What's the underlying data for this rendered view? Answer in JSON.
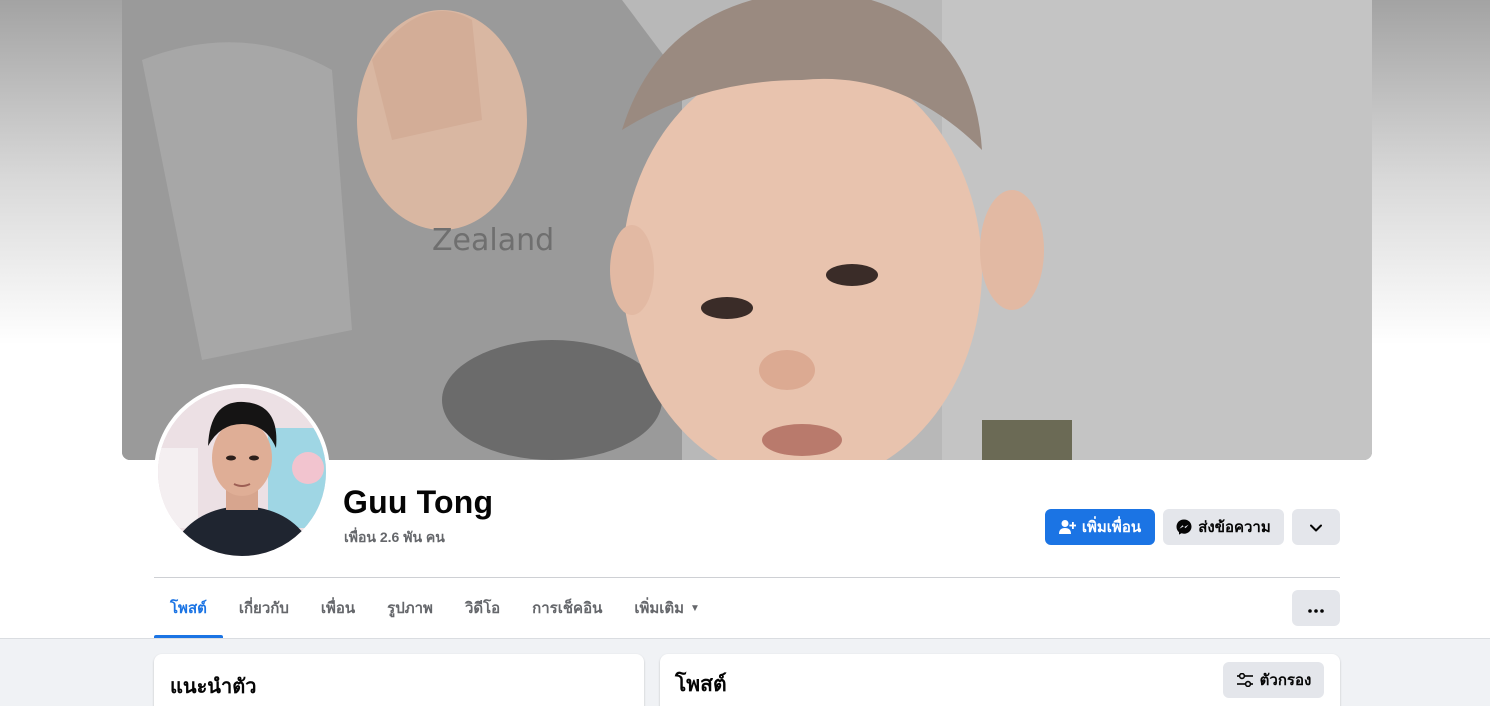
{
  "profile": {
    "name": "Guu Tong",
    "friends": "เพื่อน 2.6 พัน คน"
  },
  "actions": {
    "add_friend": "เพิ่มเพื่อน",
    "message": "ส่งข้อความ"
  },
  "tabs": [
    {
      "label": "โพสต์",
      "active": true
    },
    {
      "label": "เกี่ยวกับ"
    },
    {
      "label": "เพื่อน"
    },
    {
      "label": "รูปภาพ"
    },
    {
      "label": "วิดีโอ"
    },
    {
      "label": "การเช็คอิน"
    },
    {
      "label": "เพิ่มเติม"
    }
  ],
  "intro": {
    "title": "แนะนำตัว"
  },
  "posts": {
    "title": "โพสต์",
    "filter_label": "ตัวกรอง"
  },
  "colors": {
    "accent": "#1b74e4",
    "secondary_button": "#e4e6eb",
    "muted_text": "#65676b",
    "page_bg": "#f0f2f5"
  },
  "icons": [
    "add-friend-icon",
    "messenger-icon",
    "chevron-down-icon",
    "more-icon",
    "filter-icon",
    "caret-down-icon"
  ]
}
